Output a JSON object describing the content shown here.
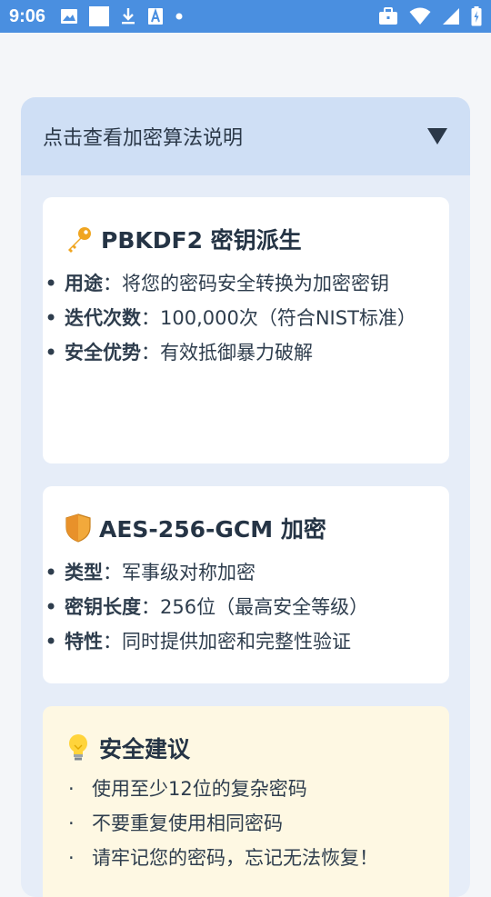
{
  "status_bar": {
    "time": "9:06",
    "left_icons": [
      "image-icon",
      "square-icon",
      "download-icon",
      "font-icon",
      "dot-icon"
    ],
    "right_icons": [
      "briefcase-icon",
      "wifi-icon",
      "signal-icon",
      "battery-icon"
    ]
  },
  "accordion": {
    "title": "点击查看加密算法说明",
    "expanded": true
  },
  "cards": {
    "pbkdf2": {
      "title": "PBKDF2 密钥派生",
      "items": [
        {
          "label": "用途",
          "sep": "：",
          "value": "将您的密码安全转换为加密密钥"
        },
        {
          "label": "迭代次数",
          "sep": "：",
          "value": "100,000次（符合NIST标准）"
        },
        {
          "label": "安全优势",
          "sep": "：",
          "value": "有效抵御暴力破解"
        }
      ]
    },
    "aes": {
      "title": "AES-256-GCM 加密",
      "items": [
        {
          "label": "类型",
          "sep": "：",
          "value": "军事级对称加密"
        },
        {
          "label": "密钥长度",
          "sep": "：",
          "value": "256位（最高安全等级）"
        },
        {
          "label": "特性",
          "sep": "：",
          "value": "同时提供加密和完整性验证"
        }
      ]
    },
    "tips": {
      "title": "安全建议",
      "bullet": "·",
      "items": [
        "使用至少12位的复杂密码",
        "不要重复使用相同密码",
        "请牢记您的密码，忘记无法恢复！"
      ]
    }
  },
  "colors": {
    "status_bar": "#4a8fe0",
    "panel_bg": "#e6edf8",
    "header_bg": "#cfdff5",
    "tip_bg": "#fef8e3",
    "text": "#253445"
  }
}
